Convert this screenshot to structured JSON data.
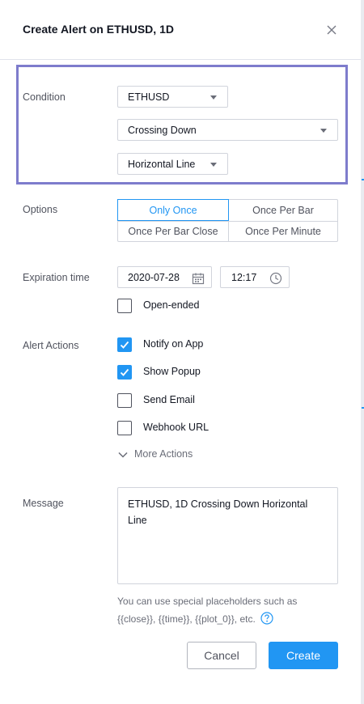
{
  "header": {
    "title": "Create Alert on ETHUSD, 1D"
  },
  "condition": {
    "label": "Condition",
    "symbol": "ETHUSD",
    "operator": "Crossing Down",
    "target": "Horizontal Line"
  },
  "options": {
    "label": "Options",
    "items": [
      "Only Once",
      "Once Per Bar",
      "Once Per Bar Close",
      "Once Per Minute"
    ],
    "selected": "Only Once"
  },
  "expiration": {
    "label": "Expiration time",
    "date": "2020-07-28",
    "time": "12:17",
    "open_ended_label": "Open-ended",
    "open_ended_checked": false
  },
  "alert_actions": {
    "label": "Alert Actions",
    "items": [
      {
        "label": "Notify on App",
        "checked": true
      },
      {
        "label": "Show Popup",
        "checked": true
      },
      {
        "label": "Send Email",
        "checked": false
      },
      {
        "label": "Webhook URL",
        "checked": false
      }
    ],
    "more_label": "More Actions"
  },
  "message": {
    "label": "Message",
    "value": "ETHUSD, 1D Crossing Down Horizontal Line",
    "hint": "You can use special placeholders such as {{close}}, {{time}}, {{plot_0}}, etc."
  },
  "buttons": {
    "cancel": "Cancel",
    "create": "Create"
  },
  "colors": {
    "accent": "#2196f3",
    "highlight": "#7e7ccc",
    "text": "#131722",
    "muted": "#50535e",
    "border": "#d1d4dc"
  }
}
